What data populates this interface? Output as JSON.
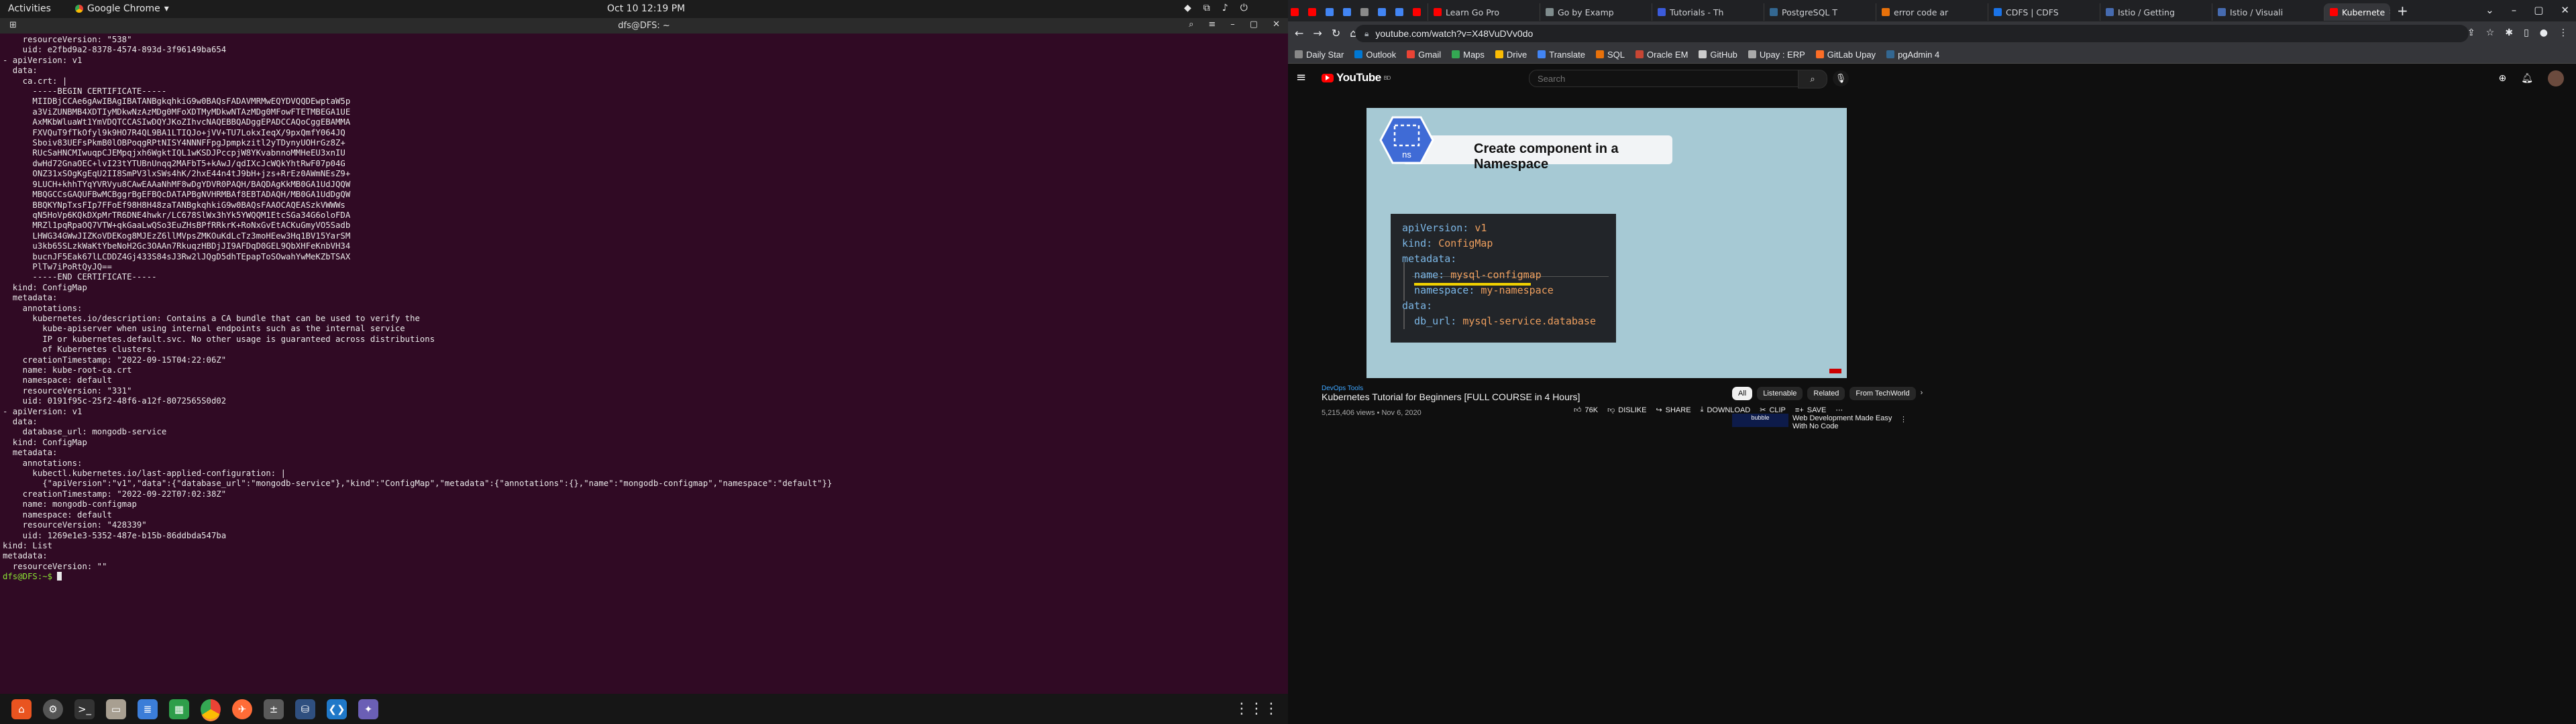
{
  "topbar": {
    "activities": "Activities",
    "app_name": "Google Chrome",
    "clock": "Oct 10  12:19 PM"
  },
  "terminal": {
    "title": "dfs@DFS: ~",
    "lines": [
      "    resourceVersion: \"538\"",
      "    uid: e2fbd9a2-8378-4574-893d-3f96149ba654",
      "- apiVersion: v1",
      "  data:",
      "    ca.crt: |",
      "      -----BEGIN CERTIFICATE-----",
      "      MIIDBjCCAe6gAwIBAgIBATANBgkqhkiG9w0BAQsFADAVMRMwEQYDVQQDEwptaW5p",
      "      a3ViZUNBMB4XDTIyMDkwNzAzMDg0MFoXDTMyMDkwNTAzMDg0MFowFTETMBEGA1UE",
      "      AxMKbWluaWt1YmVDQTCCASIwDQYJKoZIhvcNAQEBBQADggEPADCCAQoCggEBAMMA",
      "      FXVQuT9fTkOfyl9k9HO7R4QL9BA1LTIQJo+jVV+TU7LokxIeqX/9pxQmfY064JQ",
      "      Sboiv83UEFsPkmB0lOBPoqgRPtNISY4NNNFFpgJpmpkzitl2yTDynyUOHrGz8Z+",
      "      RUcSaHNCMIwuqpCJEMpqjxh6WgktIQL1wKSDJPccpjW8YKvabnnoMMHeEU3xnIU",
      "      dwHd72GnaOEC+lvI23tYTUBnUnqq2MAFbT5+kAwJ/qdIXcJcWQkYhtRwF07p04G",
      "      ONZ31xSOgKgEqU2II8SmPV3lxSWs4hK/2hxE44n4tJ9bH+jzs+RrEz0AWmNEsZ9+",
      "      9LUCH+khhTYqYVRVyu8CAwEAAaNhMF8wDgYDVR0PAQH/BAQDAgKkMB0GA1UdJQQW",
      "      MBQGCCsGAQUFBwMCBggrBgEFBQcDATAPBgNVHRMBAf8EBTADAQH/MB0GA1UdDgQW",
      "      BBQKYNpTxsFIp7FFoEf98H8H48zaTANBgkqhkiG9w0BAQsFAAOCAQEASzkVWWWs",
      "      qN5HoVp6KQkDXpMrTR6DNE4hwkr/LC678SlWx3hYk5YWQQM1EtcSGa34G6oloFDA",
      "      MRZl1pqRpaOQ7VTW+qkGaaLwQSo3EuZHsBPfRRkrK+RoNxGvEtACKuGmyVO5Sadb",
      "      LHWG34GWwJIZKoVDEKog8MJEzZ6llMVpsZMKOuKdLcTz3moHEew3Hq1BV15YarSM",
      "      u3kb65SLzkWaKtYbeNoH2Gc3OAAn7RkuqzHBDjJI9AFDqD0GEL9QbXHFeKnbVH34",
      "      bucnJF5Eak67lLCDDZ4Gj433S84sJ3Rw2lJQgD5dhTEpapToSOwahYwMeKZbTSAX",
      "      PlTw7iPoRtQyJQ==",
      "      -----END CERTIFICATE-----",
      "  kind: ConfigMap",
      "  metadata:",
      "    annotations:",
      "      kubernetes.io/description: Contains a CA bundle that can be used to verify the",
      "        kube-apiserver when using internal endpoints such as the internal service",
      "        IP or kubernetes.default.svc. No other usage is guaranteed across distributions",
      "        of Kubernetes clusters.",
      "    creationTimestamp: \"2022-09-15T04:22:06Z\"",
      "    name: kube-root-ca.crt",
      "    namespace: default",
      "    resourceVersion: \"331\"",
      "    uid: 0191f95c-25f2-48f6-a12f-8072565S0d02",
      "- apiVersion: v1",
      "  data:",
      "    database_url: mongodb-service",
      "  kind: ConfigMap",
      "  metadata:",
      "    annotations:",
      "      kubectl.kubernetes.io/last-applied-configuration: |",
      "        {\"apiVersion\":\"v1\",\"data\":{\"database_url\":\"mongodb-service\"},\"kind\":\"ConfigMap\",\"metadata\":{\"annotations\":{},\"name\":\"mongodb-configmap\",\"namespace\":\"default\"}}",
      "    creationTimestamp: \"2022-09-22T07:02:38Z\"",
      "    name: mongodb-configmap",
      "    namespace: default",
      "    resourceVersion: \"428339\"",
      "    uid: 1269e1e3-5352-487e-b15b-86ddbda547ba",
      "kind: List",
      "metadata:",
      "  resourceVersion: \"\""
    ],
    "prompt": "dfs@DFS:~$ "
  },
  "browser": {
    "tabs": [
      {
        "label": "",
        "color": "#ff0000"
      },
      {
        "label": "",
        "color": "#ff0000"
      },
      {
        "label": "",
        "color": "#4285f4"
      },
      {
        "label": "",
        "color": "#4285f4"
      },
      {
        "label": "",
        "color": "#8a8a8a"
      },
      {
        "label": "",
        "color": "#4285f4"
      },
      {
        "label": "",
        "color": "#4285f4"
      },
      {
        "label": "",
        "color": "#ff0000"
      },
      {
        "label": "Learn Go Pro",
        "color": "#ff0000"
      },
      {
        "label": "Go by Examp",
        "color": "#7f8c8d"
      },
      {
        "label": "Tutorials - Th",
        "color": "#3b5bdb"
      },
      {
        "label": "PostgreSQL T",
        "color": "#336791"
      },
      {
        "label": "error code ar",
        "color": "#e8710a"
      },
      {
        "label": "CDFS | CDFS",
        "color": "#1a73e8"
      },
      {
        "label": "Istio / Getting",
        "color": "#466bb0"
      },
      {
        "label": "Istio / Visuali",
        "color": "#466bb0"
      },
      {
        "label": "Kubernete",
        "color": "#ff0000"
      }
    ],
    "url": "youtube.com/watch?v=X48VuDVv0do",
    "bookmarks": [
      {
        "label": "Daily Star",
        "color": "#888888"
      },
      {
        "label": "Outlook",
        "color": "#0078d4"
      },
      {
        "label": "Gmail",
        "color": "#ea4335"
      },
      {
        "label": "Maps",
        "color": "#34a853"
      },
      {
        "label": "Drive",
        "color": "#fbbc04"
      },
      {
        "label": "Translate",
        "color": "#4285f4"
      },
      {
        "label": "SQL",
        "color": "#e8710a"
      },
      {
        "label": "Oracle EM",
        "color": "#c74634"
      },
      {
        "label": "GitHub",
        "color": "#cccccc"
      },
      {
        "label": "Upay : ERP",
        "color": "#aaaaaa"
      },
      {
        "label": "GitLab Upay",
        "color": "#fc6d26"
      },
      {
        "label": "pgAdmin 4",
        "color": "#336791"
      }
    ]
  },
  "youtube": {
    "logo": "YouTube",
    "logo_badge": "BD",
    "search_placeholder": "Search",
    "video": {
      "banner": "Create component in a Namespace",
      "ns": "ns",
      "code": [
        {
          "key": "apiVersion: ",
          "val": "v1"
        },
        {
          "key": "kind: ",
          "val": "ConfigMap"
        },
        {
          "key": "metadata:",
          "val": ""
        },
        {
          "key": "  name: ",
          "val": "mysql-configmap"
        },
        {
          "key": "  namespace: ",
          "val": "my-namespace"
        },
        {
          "key": "data:",
          "val": ""
        },
        {
          "key": "  db_url: ",
          "val": "mysql-service.database"
        }
      ]
    },
    "channel": "DevOps Tools",
    "title": "Kubernetes Tutorial for Beginners [FULL COURSE in 4 Hours]",
    "meta": "5,215,406 views • Nov 6, 2020",
    "actions": {
      "likes": "76K",
      "dislike": "DISLIKE",
      "share": "SHARE",
      "download": "DOWNLOAD",
      "clip": "CLIP",
      "save": "SAVE"
    },
    "chips": [
      "All",
      "Listenable",
      "Related",
      "From TechWorld"
    ],
    "rec": {
      "thumb": "bubble",
      "title": "Web Development Made Easy With No Code"
    }
  }
}
